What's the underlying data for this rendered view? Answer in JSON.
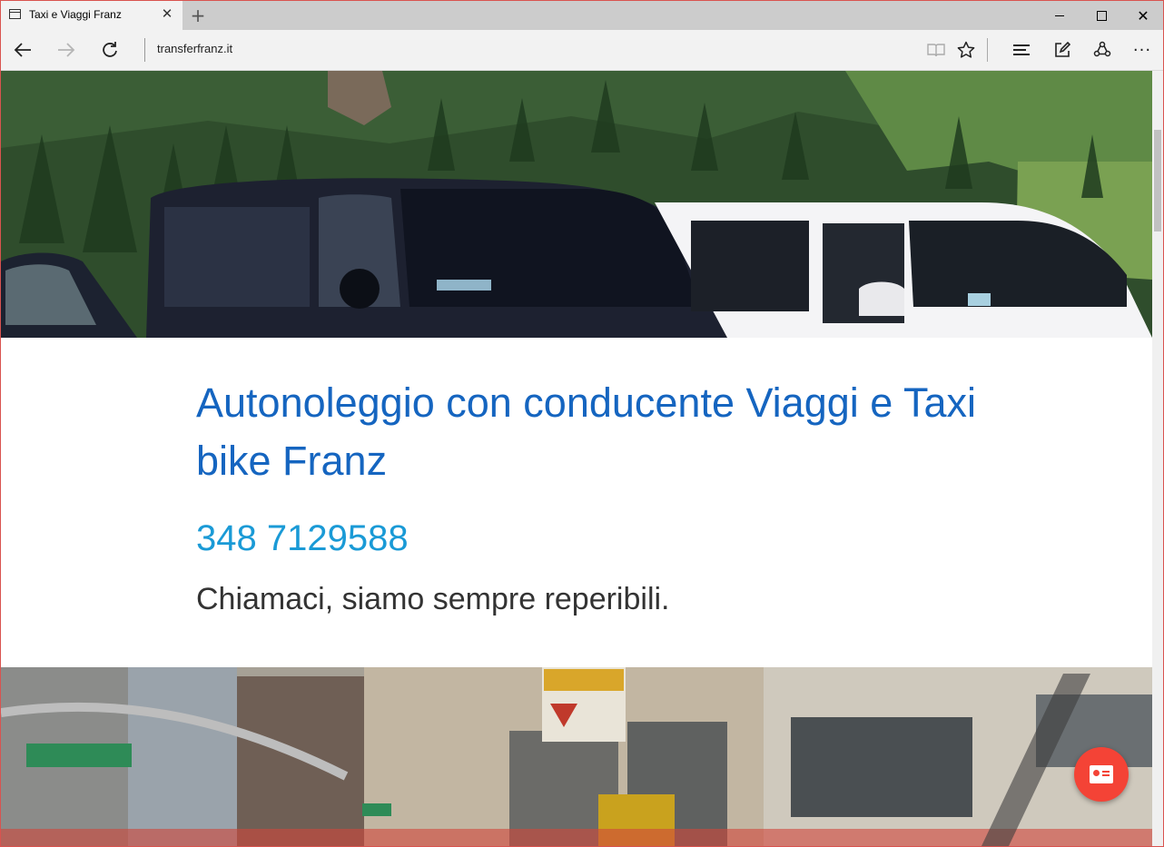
{
  "browser": {
    "tab_title": "Taxi e Viaggi Franz",
    "address": "transferfranz.it",
    "icons": {
      "back": "back-arrow-icon",
      "forward": "forward-arrow-icon",
      "refresh": "refresh-icon",
      "reading_view": "book-icon",
      "favorite": "star-icon",
      "hub": "hub-lines-icon",
      "web_note": "pen-note-icon",
      "share": "share-icon",
      "more": "more-dots-icon"
    }
  },
  "page": {
    "headline": "Autonoleggio con conducente Viaggi e Taxi bike Franz",
    "phone": "348 7129588",
    "tagline": "Chiamaci, siamo sempre reperibili.",
    "colors": {
      "headline": "#1565c0",
      "phone": "#1a9ad6",
      "fab": "#f44336"
    }
  },
  "fab": {
    "icon": "contact-card-icon"
  }
}
